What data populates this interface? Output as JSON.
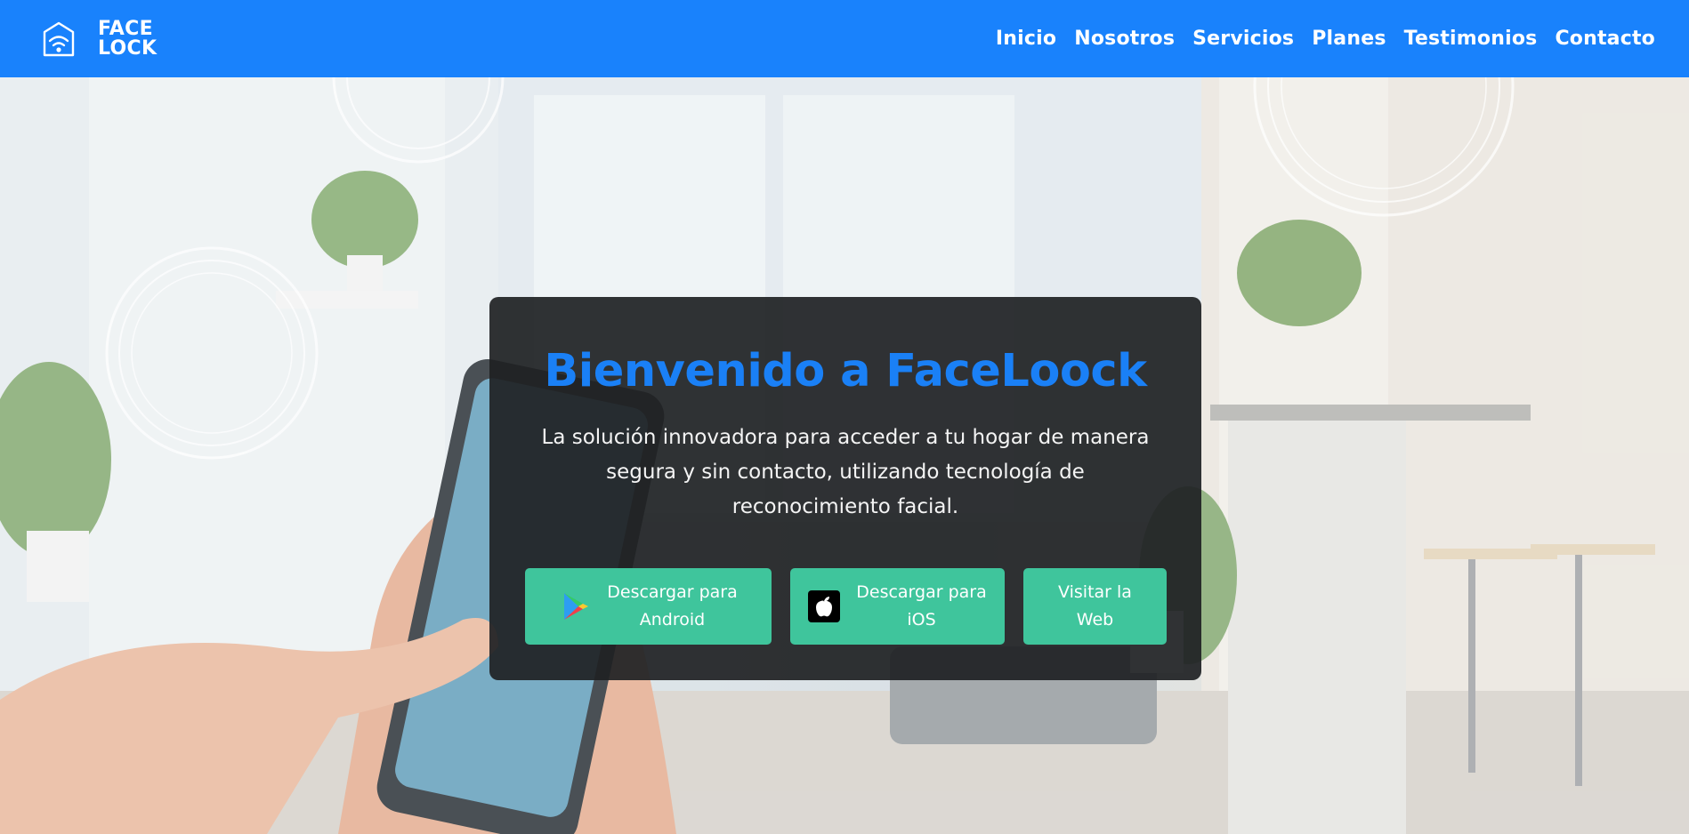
{
  "brand": {
    "line1": "FACE",
    "line2": "LOCK",
    "logo_icon": "house-wifi-icon"
  },
  "nav": {
    "items": [
      {
        "label": "Inicio"
      },
      {
        "label": "Nosotros"
      },
      {
        "label": "Servicios"
      },
      {
        "label": "Planes"
      },
      {
        "label": "Testimonios"
      },
      {
        "label": "Contacto"
      }
    ]
  },
  "hero": {
    "title": "Bienvenido a FaceLoock",
    "description": "La solución innovadora para acceder a tu hogar de manera segura y sin contacto, utilizando tecnología de reconocimiento facial.",
    "buttons": {
      "android": {
        "line1": "Descargar para",
        "line2": "Android",
        "icon": "google-play-icon"
      },
      "ios": {
        "line1": "Descargar para",
        "line2": "iOS",
        "icon": "apple-icon"
      },
      "web": {
        "line1": "Visitar la",
        "line2": "Web"
      }
    }
  },
  "colors": {
    "navbar": "#1982fc",
    "title": "#1a80f6",
    "button": "#3fc59c",
    "card": "#1e2123"
  }
}
